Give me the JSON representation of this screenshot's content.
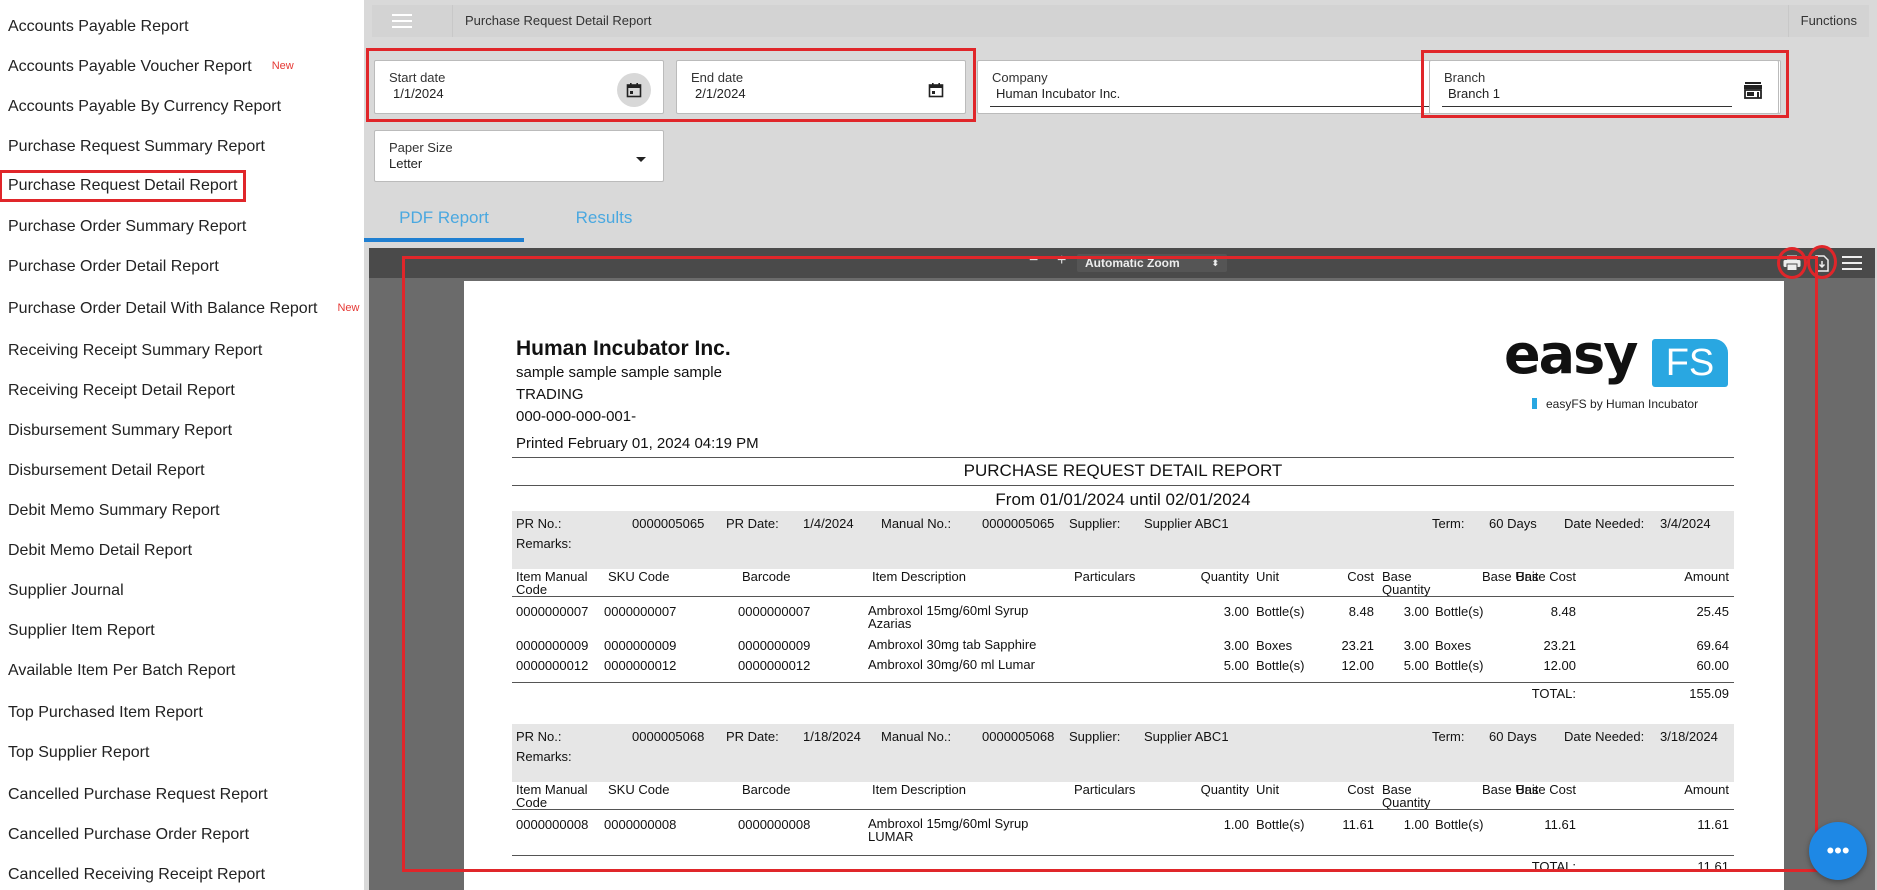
{
  "sidebar": {
    "items": [
      {
        "label": "Accounts Payable Report",
        "badge": ""
      },
      {
        "label": "Accounts Payable Voucher Report",
        "badge": "New"
      },
      {
        "label": "Accounts Payable By Currency Report",
        "badge": ""
      },
      {
        "label": "Purchase Request Summary Report",
        "badge": ""
      },
      {
        "label": "Purchase Request Detail Report",
        "badge": ""
      },
      {
        "label": "Purchase Order Summary Report",
        "badge": ""
      },
      {
        "label": "Purchase Order Detail Report",
        "badge": ""
      },
      {
        "label": "Purchase Order Detail With Balance Report",
        "badge": "New"
      },
      {
        "label": "Receiving Receipt Summary Report",
        "badge": ""
      },
      {
        "label": "Receiving Receipt Detail Report",
        "badge": ""
      },
      {
        "label": "Disbursement Summary Report",
        "badge": ""
      },
      {
        "label": "Disbursement Detail Report",
        "badge": ""
      },
      {
        "label": "Debit Memo Summary Report",
        "badge": ""
      },
      {
        "label": "Debit Memo Detail Report",
        "badge": ""
      },
      {
        "label": "Supplier Journal",
        "badge": ""
      },
      {
        "label": "Supplier Item Report",
        "badge": ""
      },
      {
        "label": "Available Item Per Batch Report",
        "badge": ""
      },
      {
        "label": "Top Purchased Item Report",
        "badge": ""
      },
      {
        "label": "Top Supplier Report",
        "badge": ""
      },
      {
        "label": "Cancelled Purchase Request Report",
        "badge": ""
      },
      {
        "label": "Cancelled Purchase Order Report",
        "badge": ""
      },
      {
        "label": "Cancelled Receiving Receipt Report",
        "badge": ""
      }
    ]
  },
  "topbar": {
    "title": "Purchase Request Detail Report",
    "functions": "Functions"
  },
  "filters": {
    "start_date": {
      "label": "Start date",
      "value": "1/1/2024"
    },
    "end_date": {
      "label": "End date",
      "value": "2/1/2024"
    },
    "company": {
      "label": "Company",
      "value": "Human Incubator Inc."
    },
    "branch": {
      "label": "Branch",
      "value": "Branch 1"
    },
    "paper_size": {
      "label": "Paper Size",
      "value": "Letter"
    }
  },
  "tabs": {
    "pdf": "PDF Report",
    "results": "Results"
  },
  "viewer": {
    "zoom_minus": "−",
    "zoom_plus": "+",
    "zoom": "Automatic Zoom"
  },
  "report": {
    "company": "Human Incubator Inc.",
    "address": "sample sample sample sample",
    "business": "TRADING",
    "tin": " 000-000-000-001-",
    "printed": "Printed February 01, 2024 04:19 PM",
    "logo_easy": "easy",
    "logo_fs": "FS",
    "logo_tagline": "easyFS by Human Incubator",
    "title": "PURCHASE REQUEST DETAIL REPORT",
    "range": "From 01/01/2024 until 02/01/2024",
    "labels": {
      "pr_no": "PR No.:",
      "pr_date": "PR Date:",
      "manual_no": "Manual No.:",
      "supplier": "Supplier:",
      "term": "Term:",
      "date_needed": "Date Needed:",
      "remarks": "Remarks:",
      "total": "TOTAL:"
    },
    "columns": {
      "item_manual_code": "Item Manual Code",
      "sku_code": "SKU Code",
      "barcode": "Barcode",
      "item_description": "Item Description",
      "particulars": "Particulars",
      "quantity": "Quantity",
      "unit": "Unit",
      "cost": "Cost",
      "base_quantity": "Base Quantity",
      "base_unit": "Base Unit",
      "base_cost": "Base Cost",
      "amount": "Amount"
    },
    "requests": [
      {
        "pr_no": "0000005065",
        "pr_date": "1/4/2024",
        "manual_no": "0000005065",
        "supplier": "Supplier ABC1",
        "term": "60 Days",
        "date_needed": "3/4/2024",
        "total": "155.09",
        "rows": [
          {
            "manual": "0000000007",
            "sku": "0000000007",
            "barcode": "0000000007",
            "desc": "Ambroxol 15mg/60ml Syrup Azarias",
            "qty": "3.00",
            "unit": "Bottle(s)",
            "cost": "8.48",
            "bqty": "3.00",
            "bunit": "Bottle(s)",
            "bcost": "8.48",
            "amount": "25.45"
          },
          {
            "manual": "0000000009",
            "sku": "0000000009",
            "barcode": "0000000009",
            "desc": "Ambroxol 30mg tab Sapphire",
            "qty": "3.00",
            "unit": "Boxes",
            "cost": "23.21",
            "bqty": "3.00",
            "bunit": "Boxes",
            "bcost": "23.21",
            "amount": "69.64"
          },
          {
            "manual": "0000000012",
            "sku": "0000000012",
            "barcode": "0000000012",
            "desc": "Ambroxol 30mg/60 ml Lumar",
            "qty": "5.00",
            "unit": "Bottle(s)",
            "cost": "12.00",
            "bqty": "5.00",
            "bunit": "Bottle(s)",
            "bcost": "12.00",
            "amount": "60.00"
          }
        ]
      },
      {
        "pr_no": "0000005068",
        "pr_date": "1/18/2024",
        "manual_no": "0000005068",
        "supplier": "Supplier ABC1",
        "term": "60 Days",
        "date_needed": "3/18/2024",
        "total": "11.61",
        "rows": [
          {
            "manual": "0000000008",
            "sku": "0000000008",
            "barcode": "0000000008",
            "desc": "Ambroxol 15mg/60ml Syrup LUMAR",
            "qty": "1.00",
            "unit": "Bottle(s)",
            "cost": "11.61",
            "bqty": "1.00",
            "bunit": "Bottle(s)",
            "bcost": "11.61",
            "amount": "11.61"
          }
        ]
      }
    ]
  },
  "colors": {
    "accent": "#1f7fd1",
    "tab_text": "#4aa8e0",
    "highlight": "#e0262a",
    "logo_blue": "#29a7e1",
    "new_badge": "#e53935"
  }
}
